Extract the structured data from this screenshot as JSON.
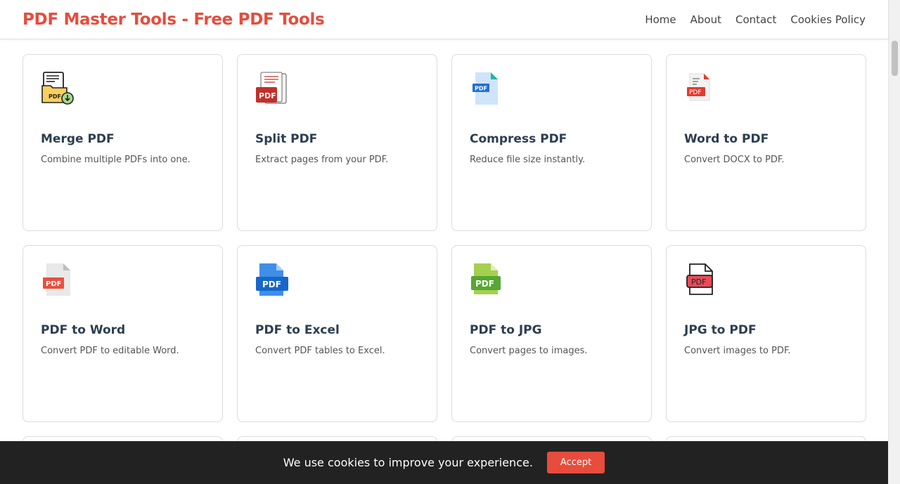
{
  "header": {
    "brand": "PDF Master Tools - Free PDF Tools",
    "nav": [
      "Home",
      "About",
      "Contact",
      "Cookies Policy"
    ]
  },
  "tools": [
    {
      "title": "Merge PDF",
      "desc": "Combine multiple PDFs into one.",
      "icon": "merge-pdf-icon"
    },
    {
      "title": "Split PDF",
      "desc": "Extract pages from your PDF.",
      "icon": "split-pdf-icon"
    },
    {
      "title": "Compress PDF",
      "desc": "Reduce file size instantly.",
      "icon": "compress-pdf-icon"
    },
    {
      "title": "Word to PDF",
      "desc": "Convert DOCX to PDF.",
      "icon": "word-to-pdf-icon"
    },
    {
      "title": "PDF to Word",
      "desc": "Convert PDF to editable Word.",
      "icon": "pdf-to-word-icon"
    },
    {
      "title": "PDF to Excel",
      "desc": "Convert PDF tables to Excel.",
      "icon": "pdf-to-excel-icon"
    },
    {
      "title": "PDF to JPG",
      "desc": "Convert pages to images.",
      "icon": "pdf-to-jpg-icon"
    },
    {
      "title": "JPG to PDF",
      "desc": "Convert images to PDF.",
      "icon": "jpg-to-pdf-icon"
    }
  ],
  "icon_text": "PDF",
  "cookie": {
    "message": "We use cookies to improve your experience.",
    "accept_label": "Accept"
  },
  "colors": {
    "brand": "#e74c3c",
    "cookie_bg": "#222222",
    "title": "#2c3e50"
  }
}
